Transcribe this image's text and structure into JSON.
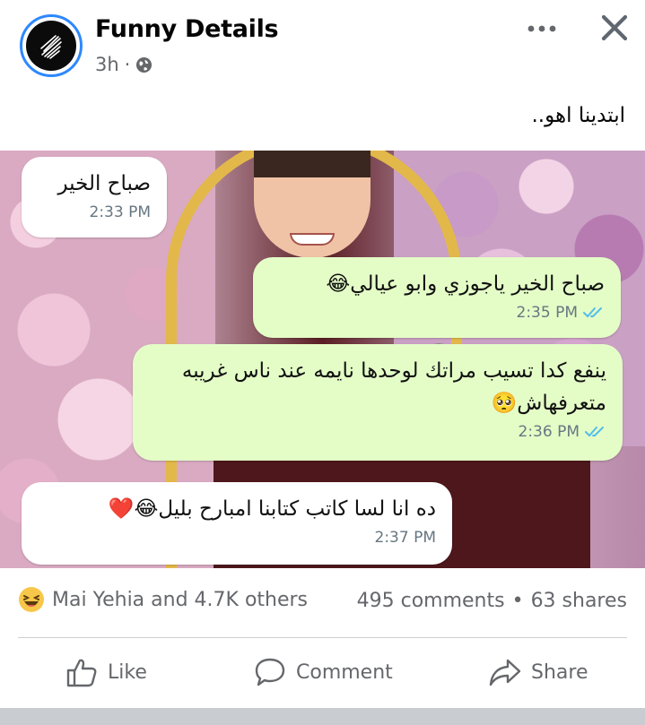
{
  "post": {
    "page_name": "Funny Details",
    "time": "3h",
    "separator": "·",
    "privacy_icon": "globe-icon",
    "caption": "ابتدينا اهو.."
  },
  "header": {
    "more_icon": "more-icon",
    "close_icon": "close-icon"
  },
  "chat": [
    {
      "direction": "in",
      "text": "صباح الخير",
      "time": "2:33 PM"
    },
    {
      "direction": "out",
      "text": "صباح الخير ياجوزي وابو عيالي😂",
      "time": "2:35 PM"
    },
    {
      "direction": "out",
      "text": "ينفع كدا تسيب مراتك لوحدها نايمه عند ناس غريبه متعرفهاش🥺",
      "time": "2:36 PM"
    },
    {
      "direction": "in",
      "text": "ده انا لسا كاتب كتابنا امبارح بليل😂❤️",
      "time": "2:37 PM"
    }
  ],
  "engagement": {
    "reactions_text": "Mai Yehia and 4.7K others",
    "comments": "495 comments",
    "dot": "•",
    "shares": "63 shares"
  },
  "actions": {
    "like": "Like",
    "comment": "Comment",
    "share": "Share"
  },
  "colors": {
    "accent": "#2d88ff",
    "outgoing_bubble": "#e4fdc7",
    "ticks": "#53bdeb",
    "secondary_text": "#65676b"
  }
}
